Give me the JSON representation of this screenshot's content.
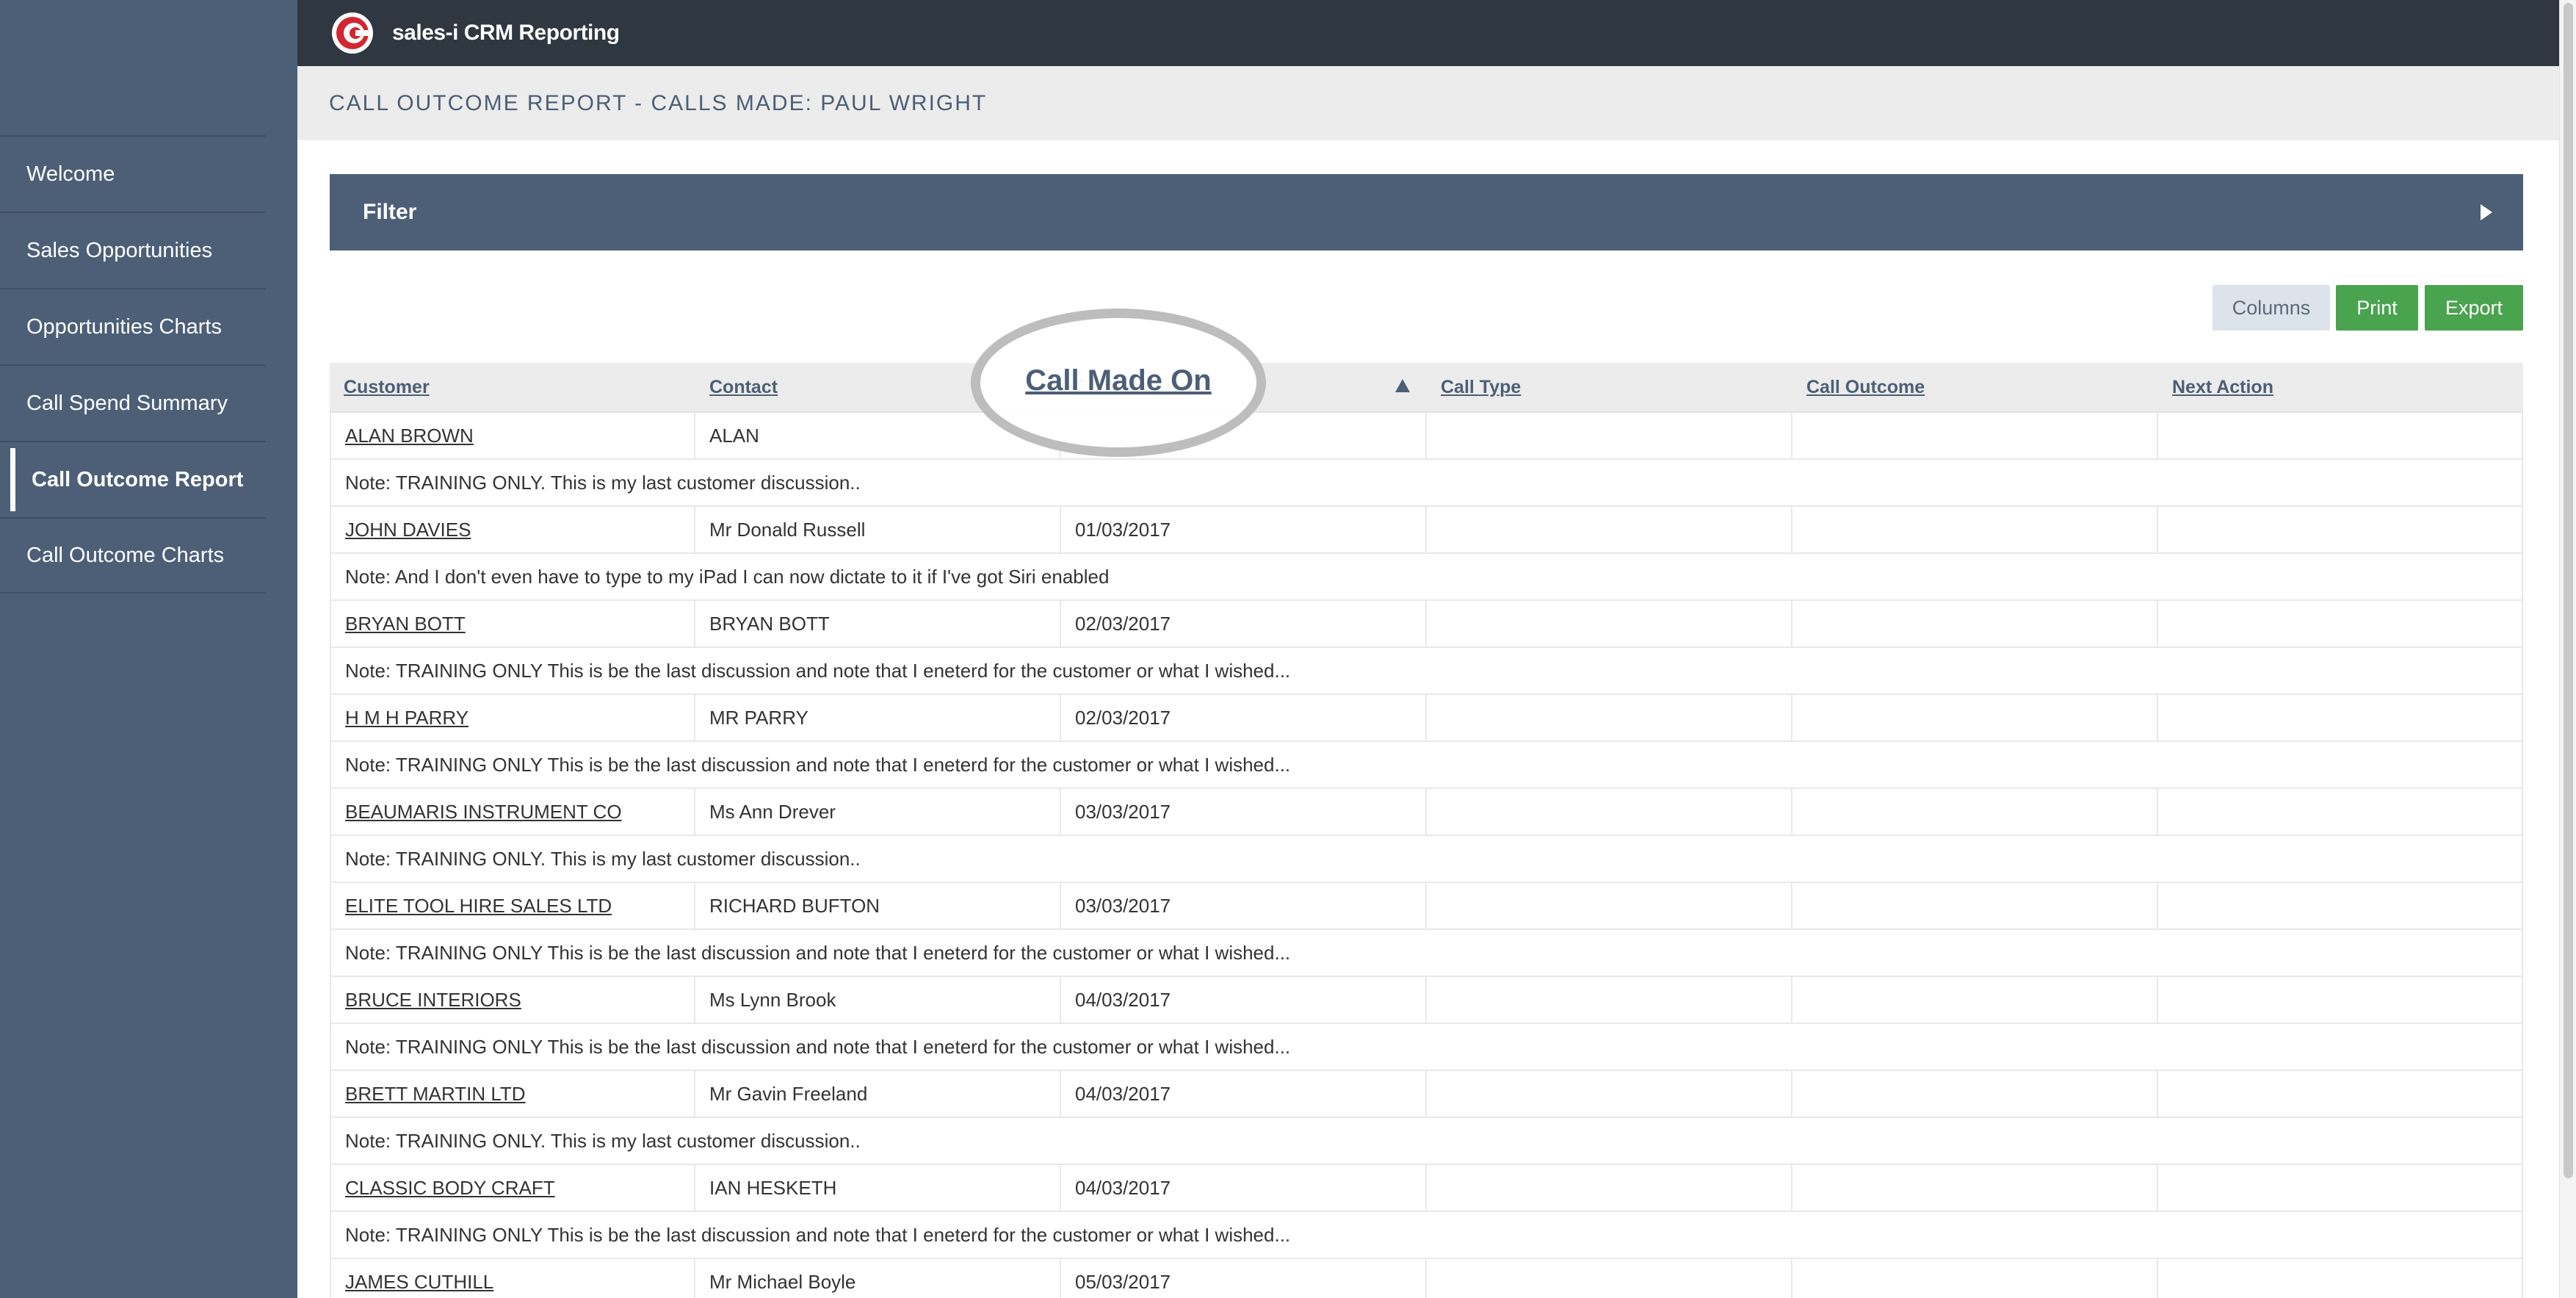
{
  "app": {
    "title": "sales-i CRM Reporting"
  },
  "page": {
    "title": "CALL OUTCOME REPORT - CALLS MADE: PAUL WRIGHT"
  },
  "sidebar": {
    "items": [
      {
        "label": "Welcome",
        "active": false
      },
      {
        "label": "Sales Opportunities",
        "active": false
      },
      {
        "label": "Opportunities Charts",
        "active": false
      },
      {
        "label": "Call Spend Summary",
        "active": false
      },
      {
        "label": "Call Outcome Report",
        "active": true
      },
      {
        "label": "Call Outcome Charts",
        "active": false
      }
    ]
  },
  "filter": {
    "label": "Filter"
  },
  "toolbar": {
    "columns_label": "Columns",
    "print_label": "Print",
    "export_label": "Export"
  },
  "table": {
    "headers": [
      "Customer",
      "Contact",
      "Call Made On",
      "Call Type",
      "Call Outcome",
      "Next Action"
    ],
    "sort_column": "Call Made On",
    "rows": [
      {
        "customer": "ALAN BROWN",
        "contact": "ALAN",
        "date": "",
        "type": "",
        "outcome": "",
        "next": "",
        "note": "Note: TRAINING ONLY. This is my last customer discussion.."
      },
      {
        "customer": "JOHN DAVIES",
        "contact": "Mr Donald Russell",
        "date": "01/03/2017",
        "type": "",
        "outcome": "",
        "next": "",
        "note": "Note: And I don't even have to type to my iPad I can now dictate to it if I've got Siri enabled"
      },
      {
        "customer": "BRYAN BOTT",
        "contact": "BRYAN BOTT",
        "date": "02/03/2017",
        "type": "",
        "outcome": "",
        "next": "",
        "note": "Note: TRAINING ONLY This is be the last discussion and note that I eneterd for the customer or what I wished..."
      },
      {
        "customer": "H M H PARRY",
        "contact": "MR PARRY",
        "date": "02/03/2017",
        "type": "",
        "outcome": "",
        "next": "",
        "note": "Note: TRAINING ONLY This is be the last discussion and note that I eneterd for the customer or what I wished..."
      },
      {
        "customer": "BEAUMARIS INSTRUMENT CO",
        "contact": "Ms Ann Drever",
        "date": "03/03/2017",
        "type": "",
        "outcome": "",
        "next": "",
        "note": "Note: TRAINING ONLY. This is my last customer discussion.."
      },
      {
        "customer": "ELITE TOOL HIRE SALES LTD",
        "contact": "RICHARD BUFTON",
        "date": "03/03/2017",
        "type": "",
        "outcome": "",
        "next": "",
        "note": "Note: TRAINING ONLY This is be the last discussion and note that I eneterd for the customer or what I wished..."
      },
      {
        "customer": "BRUCE INTERIORS",
        "contact": "Ms Lynn Brook",
        "date": "04/03/2017",
        "type": "",
        "outcome": "",
        "next": "",
        "note": "Note: TRAINING ONLY This is be the last discussion and note that I eneterd for the customer or what I wished..."
      },
      {
        "customer": "BRETT MARTIN LTD",
        "contact": "Mr Gavin Freeland",
        "date": "04/03/2017",
        "type": "",
        "outcome": "",
        "next": "",
        "note": "Note: TRAINING ONLY. This is my last customer discussion.."
      },
      {
        "customer": "CLASSIC BODY CRAFT",
        "contact": "IAN HESKETH",
        "date": "04/03/2017",
        "type": "",
        "outcome": "",
        "next": "",
        "note": "Note: TRAINING ONLY This is be the last discussion and note that I eneterd for the customer or what I wished..."
      },
      {
        "customer": "JAMES CUTHILL",
        "contact": "Mr Michael Boyle",
        "date": "05/03/2017",
        "type": "",
        "outcome": "",
        "next": "",
        "note": ""
      }
    ]
  },
  "highlight": {
    "label": "Call Made On"
  },
  "colors": {
    "sidebar": "#4c5f77",
    "topbar": "#2f3740",
    "accent_green": "#4aa34f",
    "logo_red": "#d22630"
  },
  "icons": {
    "logo": "sales-i-logo-icon",
    "filter_toggle": "triangle-right-icon",
    "sort": "sort-asc-icon"
  }
}
